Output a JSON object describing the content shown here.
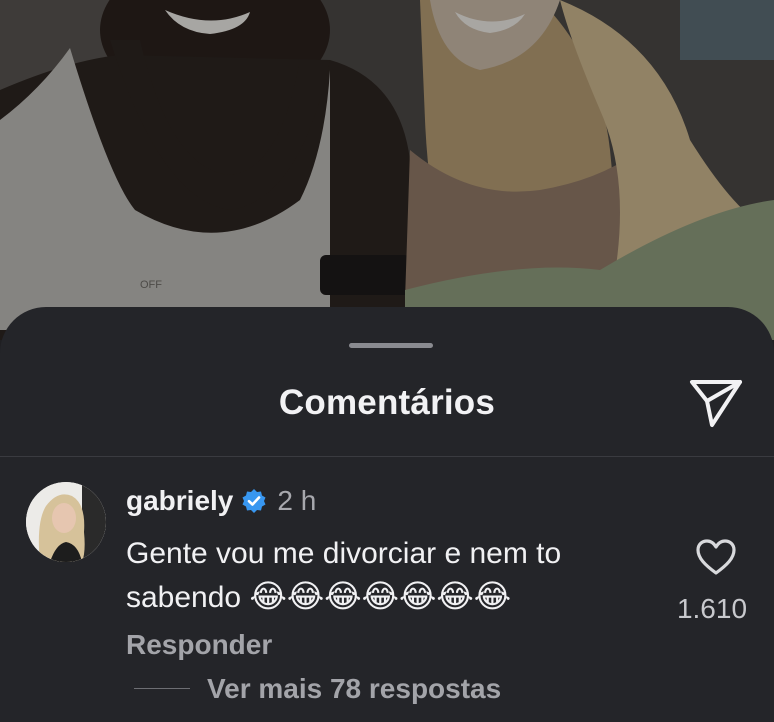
{
  "background": {
    "image": "photo-of-two-people"
  },
  "sheet": {
    "title": "Comentários",
    "share_icon": "paper-plane-icon"
  },
  "comment": {
    "username": "gabriely",
    "verified": true,
    "time": "2 h",
    "text": "Gente vou me divorciar e nem to sabendo",
    "emojis": "😂😂😂😂😂😂😂",
    "likes": "1.610",
    "reply_label": "Responder",
    "more_replies_label": "Ver mais 78 respostas",
    "like_icon": "heart-outline-icon"
  },
  "colors": {
    "sheet_bg": "#242529",
    "text_primary": "#f1f1f3",
    "text_secondary": "#a3a4a9",
    "verified_blue": "#3897f0"
  }
}
